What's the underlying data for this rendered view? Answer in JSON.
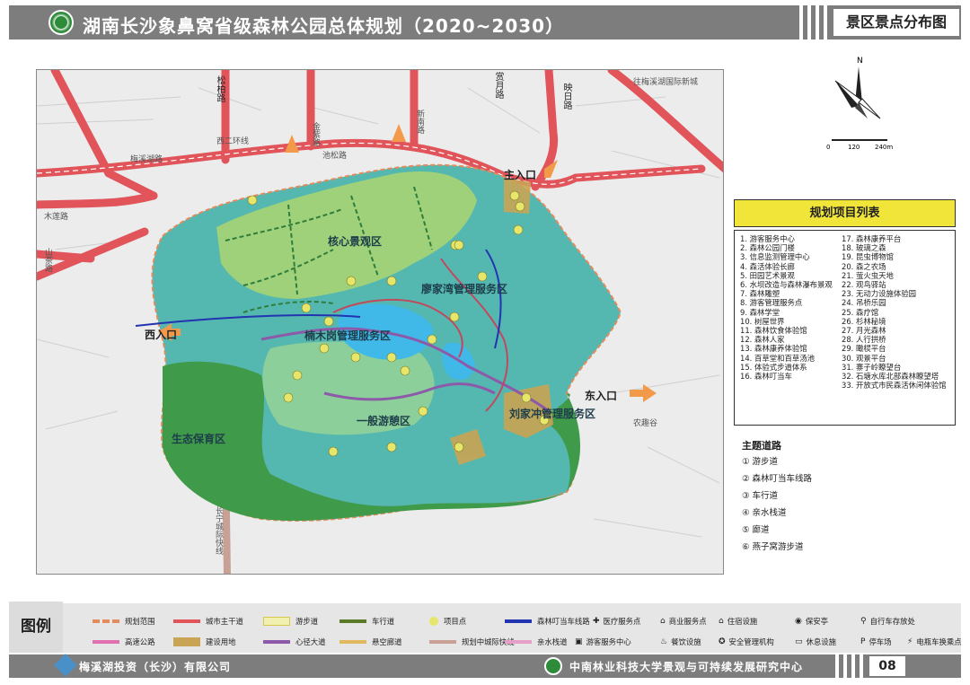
{
  "header": {
    "title": "湖南长沙象鼻窝省级森林公园总体规划（2020~2030）",
    "subtitle": "景区景点分布图"
  },
  "compass": {
    "north": "N",
    "scale": [
      "0",
      "120",
      "240m"
    ]
  },
  "map": {
    "zones": [
      "核心景观区",
      "廖家湾管理服务区",
      "楠木岗管理服务区",
      "一般游憩区",
      "刘家冲管理服务区",
      "生态保育区"
    ],
    "entrances": [
      "主入口",
      "西入口",
      "东入口"
    ],
    "roads": [
      "松柏路",
      "赏月路",
      "映日路",
      "新南路",
      "金紫路",
      "梅溪湖路",
      "西二环线",
      "木莲路",
      "山茶路",
      "池松路",
      "长宁城际快线"
    ],
    "places": [
      "往梅溪湖国际新城",
      "农趣谷"
    ]
  },
  "project_list": {
    "title": "规划项目列表",
    "left": [
      "1. 游客服务中心",
      "2. 森林公园门楼",
      "3. 信息监测管理中心",
      "4. 森活体验长廊",
      "5. 田园艺术景观",
      "6. 水坝改造与森林瀑布景观",
      "7. 森林雕塑",
      "8. 游客管理服务点",
      "9. 森林学堂",
      "10. 树屋世界",
      "11. 森林饮食体验馆",
      "12. 森林人家",
      "13. 森林康养体验馆",
      "14. 百草堂和百草汤池",
      "15. 体验式步道体系",
      "16. 森林叮当车"
    ],
    "right": [
      "17. 森林康养平台",
      "18. 玻璃之森",
      "19. 昆虫博物馆",
      "20. 森之农场",
      "21. 萤火虫天地",
      "22. 观鸟驿站",
      "23. 无动力设施体验园",
      "24. 吊桥乐园",
      "25. 森疗馆",
      "26. 杉林秘境",
      "27. 月光森林",
      "28. 人行拱桥",
      "29. 瞰棂平台",
      "30. 观景平台",
      "31. 寨子岭瞭望台",
      "32. 石塘水库北部森林瞭望塔",
      "33. 开放式市民森活休闲体验馆"
    ]
  },
  "theme_roads": {
    "title": "主题道路",
    "items": [
      "① 游步道",
      "② 森林叮当车线路",
      "③ 车行道",
      "④ 亲水栈道",
      "⑤ 廊道",
      "⑥ 燕子窝游步道"
    ]
  },
  "legend": {
    "title": "图例",
    "items": [
      "规划范围",
      "城市主干道",
      "游步道",
      "车行道",
      "项目点",
      "森林叮当车线路",
      "医疗服务点",
      "商业服务点",
      "住宿设施",
      "保安亭",
      "自行车存放处",
      "高速公路",
      "建设用地",
      "心径大道",
      "悬空廊道",
      "规划中城际快线",
      "亲水栈道",
      "游客服务中心",
      "餐饮设施",
      "安全管理机构",
      "休息设施",
      "停车场",
      "电瓶车换乘点"
    ]
  },
  "footer": {
    "company": "梅溪湖投资（长沙）有限公司",
    "institute": "中南林业科技大学景观与可持续发展研究中心",
    "page": "08"
  },
  "colors": {
    "forest_green": "#3f9a4a",
    "teal": "#55b8b0",
    "light_green": "#9fd07a",
    "water": "#40b8e8",
    "arterial_road": "#e0545a",
    "highlight_yellow": "#f2e53a",
    "header_gray": "#7d7d7d"
  }
}
